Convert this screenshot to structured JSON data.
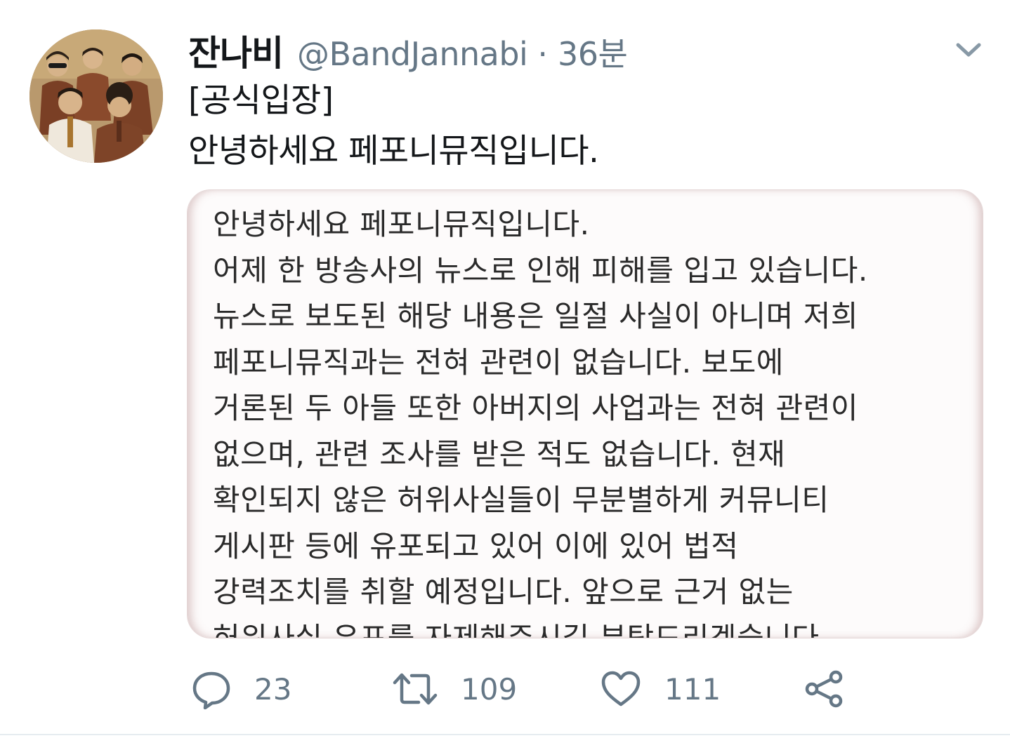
{
  "tweet": {
    "display_name": "잔나비",
    "handle": "@BandJannabi",
    "separator": "·",
    "time": "36분",
    "text_lines": [
      "[공식입장]",
      "안녕하세요 페포니뮤직입니다."
    ]
  },
  "avatar": {
    "icon": "band-photo-avatar"
  },
  "menu": {
    "icon": "chevron-down-icon"
  },
  "media": {
    "lines": [
      "안녕하세요 페포니뮤직입니다.",
      "어제 한 방송사의 뉴스로 인해 피해를 입고 있습니다.",
      "뉴스로 보도된 해당 내용은 일절 사실이 아니며 저희",
      "페포니뮤직과는 전혀 관련이 없습니다. 보도에",
      "거론된 두 아들 또한 아버지의 사업과는 전혀 관련이",
      "없으며, 관련 조사를 받은 적도 없습니다. 현재",
      "확인되지 않은 허위사실들이 무분별하게 커뮤니티",
      "게시판 등에 유포되고 있어 이에 있어 법적",
      "강력조치를 취할 예정입니다. 앞으로 근거 없는",
      "허위사실 유포를 자제해주시길 부탁드리겠습니다."
    ]
  },
  "actions": {
    "reply_count": "23",
    "retweet_count": "109",
    "like_count": "111",
    "icons": [
      "reply-icon",
      "retweet-icon",
      "like-icon",
      "share-icon"
    ]
  },
  "colors": {
    "text_primary": "#14171a",
    "text_secondary": "#657786",
    "divider": "#e6ecf0"
  }
}
